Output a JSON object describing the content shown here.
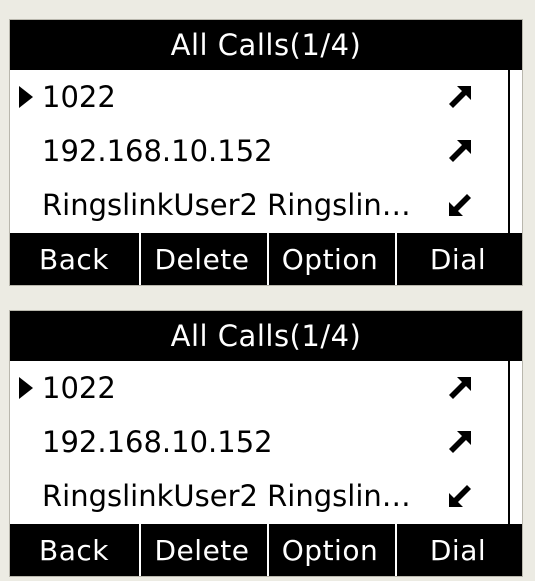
{
  "screens": [
    {
      "title": "All Calls(1/4)",
      "calls": [
        {
          "label": "1022",
          "direction": "outgoing-call-icon",
          "selected": true
        },
        {
          "label": "192.168.10.152",
          "direction": "outgoing-call-icon",
          "selected": false
        },
        {
          "label": "RingslinkUser2 Ringslin…",
          "direction": "incoming-call-icon",
          "selected": false
        }
      ],
      "softkeys": [
        "Back",
        "Delete",
        "Option",
        "Dial"
      ]
    },
    {
      "title": "All Calls(1/4)",
      "calls": [
        {
          "label": "1022",
          "direction": "outgoing-call-icon",
          "selected": true
        },
        {
          "label": "192.168.10.152",
          "direction": "outgoing-call-icon",
          "selected": false
        },
        {
          "label": "RingslinkUser2 Ringslin…",
          "direction": "incoming-call-icon",
          "selected": false
        }
      ],
      "softkeys": [
        "Back",
        "Delete",
        "Option",
        "Dial"
      ]
    }
  ],
  "scroll_position": 0.25,
  "colors": {
    "background": "#ecebe3",
    "screen": "#ffffff",
    "bar": "#000000",
    "text_on_bar": "#ffffff"
  }
}
